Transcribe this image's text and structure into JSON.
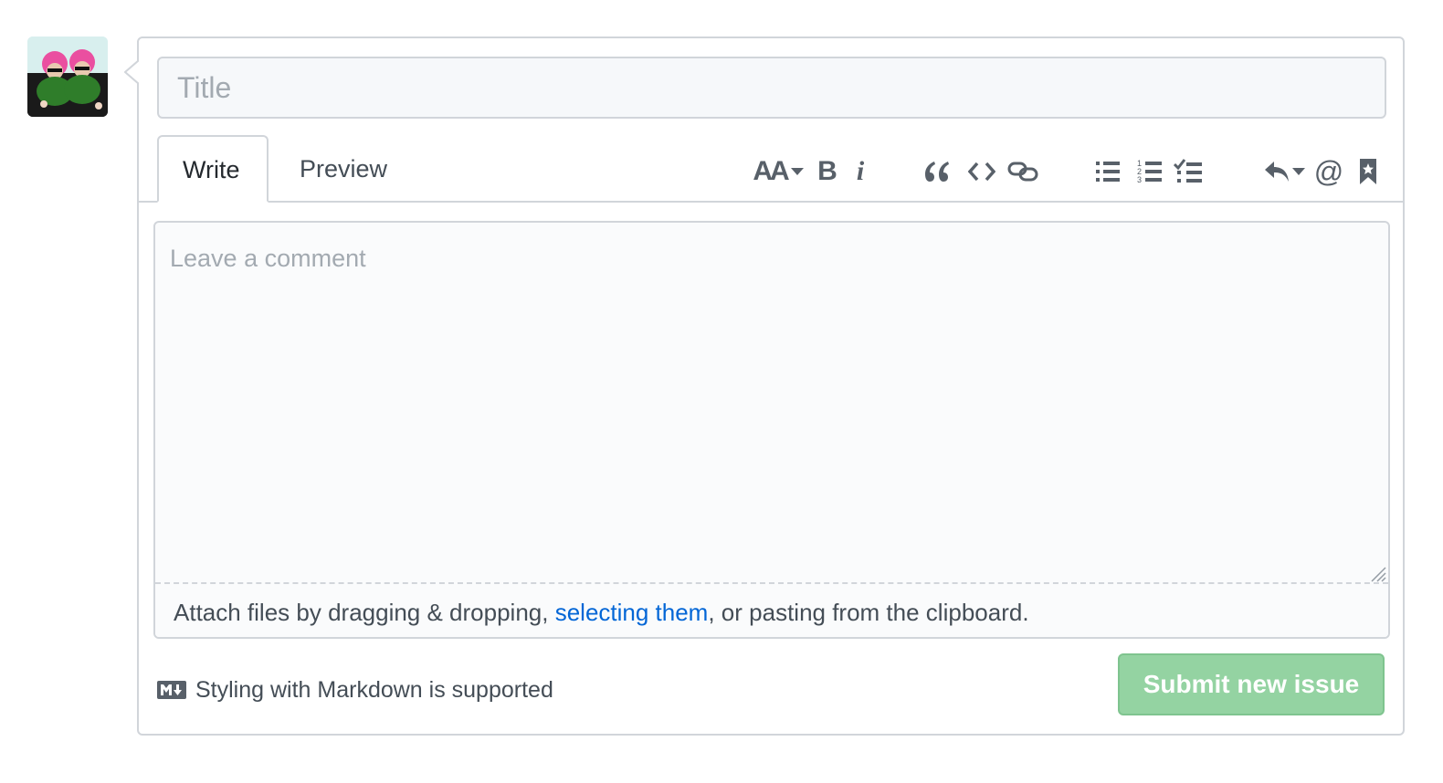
{
  "form": {
    "title_placeholder": "Title",
    "tabs": [
      {
        "label": "Write",
        "selected": true
      },
      {
        "label": "Preview",
        "selected": false
      }
    ],
    "toolbar": [
      {
        "icon": "text-size-icon",
        "text": "AA"
      },
      {
        "icon": "bold-icon",
        "text": "B"
      },
      {
        "icon": "italic-icon",
        "text": "i"
      },
      {
        "icon": "quote-icon"
      },
      {
        "icon": "code-icon"
      },
      {
        "icon": "link-icon"
      },
      {
        "icon": "unordered-list-icon"
      },
      {
        "icon": "ordered-list-icon"
      },
      {
        "icon": "task-list-icon"
      },
      {
        "icon": "reply-icon"
      },
      {
        "icon": "mention-icon",
        "text": "@"
      },
      {
        "icon": "bookmark-icon"
      }
    ],
    "comment_placeholder": "Leave a comment",
    "attach": {
      "before": "Attach files by dragging & dropping, ",
      "link": "selecting them",
      "after": ", or pasting from the clipboard."
    },
    "markdown_note": "Styling with Markdown is supported",
    "submit_label": "Submit new issue"
  },
  "colors": {
    "border": "#d1d5da",
    "link": "#0366d6",
    "submit_bg": "#94d3a2",
    "placeholder": "#a3aab1"
  }
}
